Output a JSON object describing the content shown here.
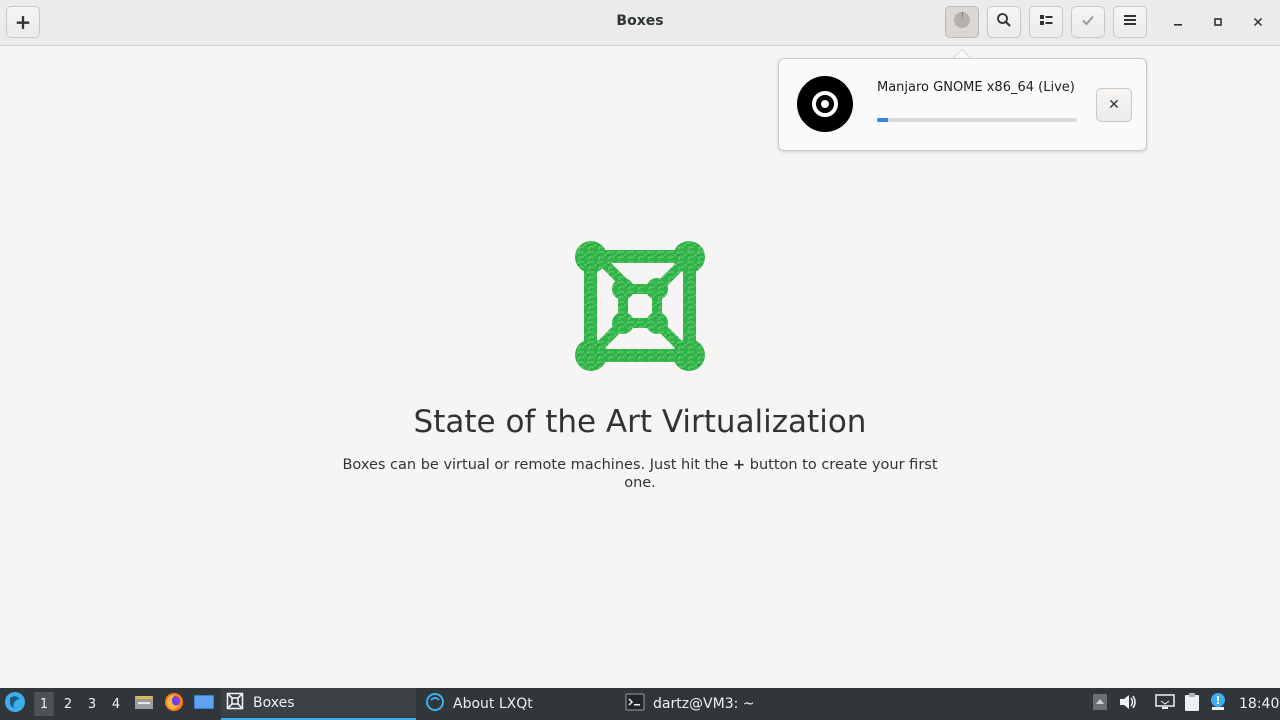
{
  "window": {
    "title": "Boxes"
  },
  "header": {
    "new_button_glyph": "+",
    "buttons": [
      {
        "name": "downloads-button",
        "icon": "progress-pie-icon"
      },
      {
        "name": "search-button",
        "icon": "search-icon"
      },
      {
        "name": "view-toggle-button",
        "icon": "list-view-icon"
      },
      {
        "name": "select-button",
        "icon": "checkmark-icon"
      },
      {
        "name": "main-menu-button",
        "icon": "hamburger-menu-icon"
      }
    ],
    "window_controls": [
      "minimize",
      "maximize",
      "close"
    ]
  },
  "downloads_popover": {
    "item_name": "Manjaro GNOME x86_64 (Live)",
    "progress_fraction": 0.055,
    "cancel_glyph": "✕",
    "icon": "disc-icon"
  },
  "empty_state": {
    "title": "State of the Art Virtualization",
    "description_before": "Boxes can be virtual or remote machines. Just hit the ",
    "description_plus": "+",
    "description_after": " button to create your first one."
  },
  "taskbar": {
    "workspaces": [
      "1",
      "2",
      "3",
      "4"
    ],
    "active_workspace": 0,
    "tasks": [
      {
        "label": "Boxes",
        "icon": "boxes-icon",
        "active": true
      },
      {
        "label": "About LXQt",
        "icon": "lxqt-icon",
        "active": false
      },
      {
        "label": "dartz@VM3: ~",
        "icon": "terminal-icon",
        "active": false
      }
    ],
    "clock": "18:40"
  },
  "colors": {
    "accent": "#3584e4",
    "taskbar_bg": "#31363b",
    "logo_green": "#2fb34a"
  }
}
